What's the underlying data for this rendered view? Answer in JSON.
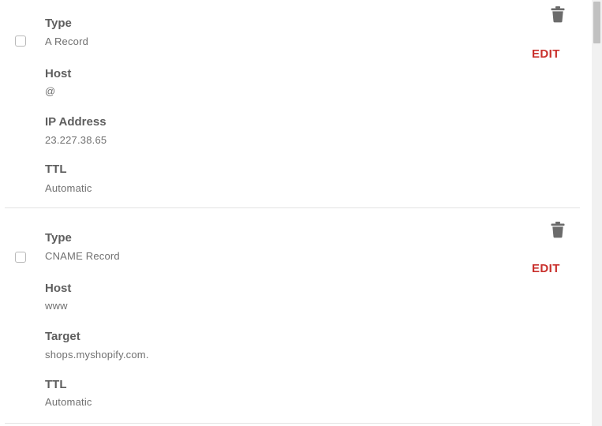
{
  "records": [
    {
      "fields": [
        {
          "label": "Type",
          "value": "A Record"
        },
        {
          "label": "Host",
          "value": "@"
        },
        {
          "label": "IP Address",
          "value": "23.227.38.65"
        },
        {
          "label": "TTL",
          "value": "Automatic"
        }
      ],
      "edit_label": "EDIT",
      "delete_icon": "trash-icon",
      "checked": false
    },
    {
      "fields": [
        {
          "label": "Type",
          "value": "CNAME Record"
        },
        {
          "label": "Host",
          "value": "www"
        },
        {
          "label": "Target",
          "value": "shops.myshopify.com."
        },
        {
          "label": "TTL",
          "value": "Automatic"
        }
      ],
      "edit_label": "EDIT",
      "delete_icon": "trash-icon",
      "checked": false
    }
  ],
  "colors": {
    "edit": "#c9302c",
    "label": "#5e5e5e",
    "value": "#707070",
    "icon": "#6b6b6b",
    "separator": "#e3e3e3"
  }
}
